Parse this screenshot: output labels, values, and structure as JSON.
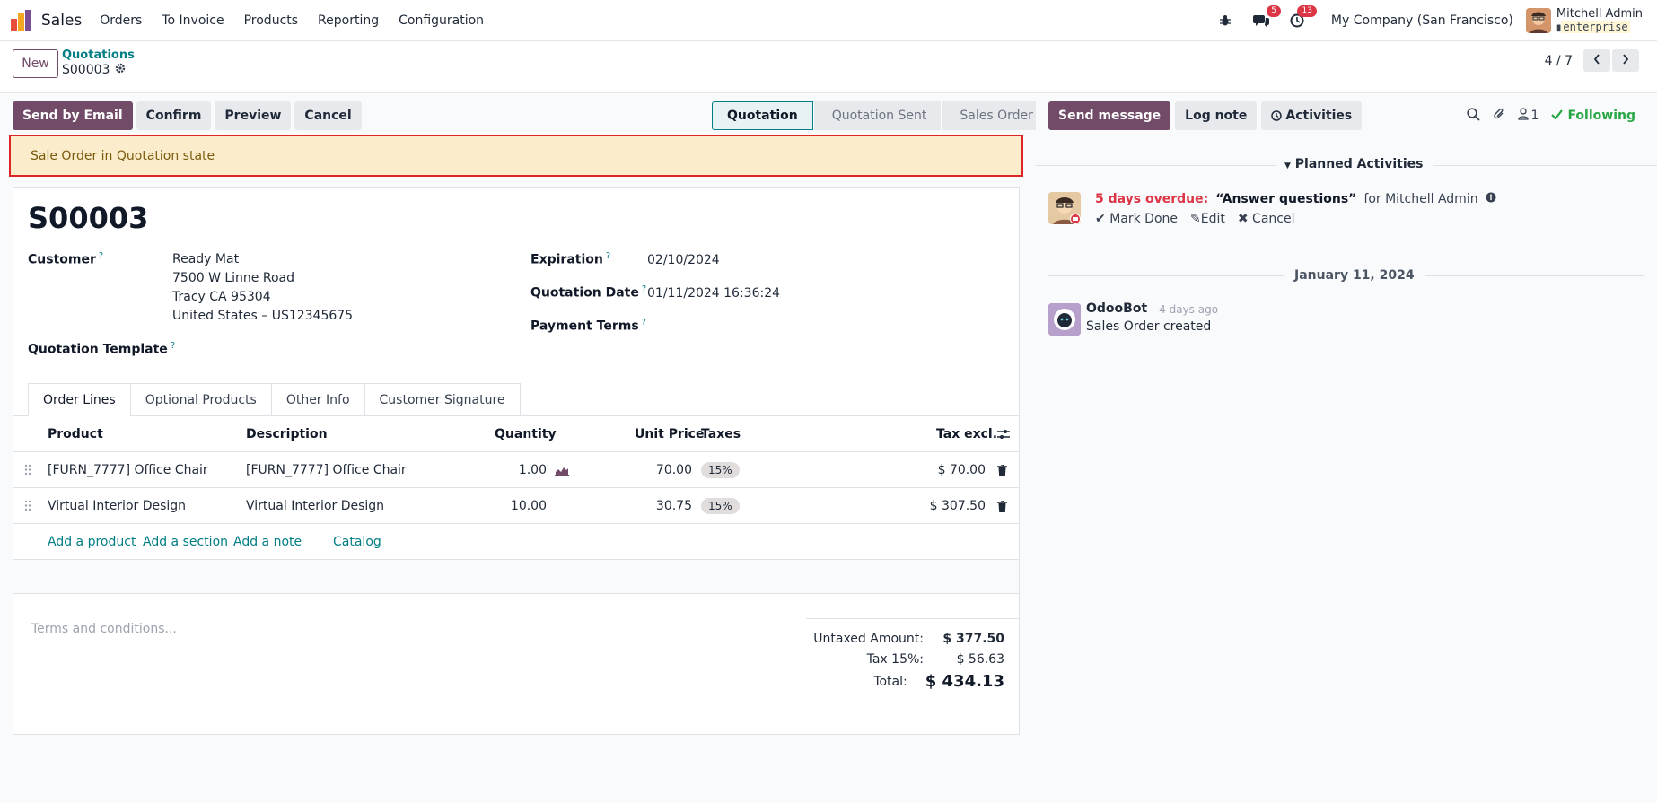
{
  "navbar": {
    "app_name": "Sales",
    "menu": [
      "Orders",
      "To Invoice",
      "Products",
      "Reporting",
      "Configuration"
    ],
    "messages_count": "5",
    "activities_count": "13",
    "company": "My Company (San Francisco)",
    "user_name": "Mitchell Admin",
    "db_name": "enterprise"
  },
  "control_panel": {
    "new_label": "New",
    "breadcrumb_parent": "Quotations",
    "breadcrumb_current": "S00003",
    "pager": "4 / 7"
  },
  "actions": {
    "send_email": "Send by Email",
    "confirm": "Confirm",
    "preview": "Preview",
    "cancel": "Cancel"
  },
  "statusbar": [
    "Quotation",
    "Quotation Sent",
    "Sales Order"
  ],
  "alert": "Sale Order in Quotation state",
  "form": {
    "name": "S00003",
    "customer_label": "Customer",
    "customer_name": "Ready Mat",
    "customer_addr1": "7500 W Linne Road",
    "customer_addr2": "Tracy CA 95304",
    "customer_addr3": "United States – US12345675",
    "template_label": "Quotation Template",
    "expiration_label": "Expiration",
    "expiration_value": "02/10/2024",
    "qdate_label": "Quotation Date",
    "qdate_value": "01/11/2024 16:36:24",
    "payment_label": "Payment Terms",
    "help_mark": "?"
  },
  "tabs": [
    "Order Lines",
    "Optional Products",
    "Other Info",
    "Customer Signature"
  ],
  "table": {
    "headers": {
      "product": "Product",
      "description": "Description",
      "quantity": "Quantity",
      "unit_price": "Unit Price",
      "taxes": "Taxes",
      "tax_excl": "Tax excl."
    },
    "rows": [
      {
        "product": "[FURN_7777] Office Chair",
        "description": "[FURN_7777] Office Chair",
        "quantity": "1.00",
        "unit_price": "70.00",
        "tax": "15%",
        "subtotal": "$ 70.00"
      },
      {
        "product": "Virtual Interior Design",
        "description": "Virtual Interior Design",
        "quantity": "10.00",
        "unit_price": "30.75",
        "tax": "15%",
        "subtotal": "$ 307.50"
      }
    ],
    "add_product": "Add a product",
    "add_section": "Add a section",
    "add_note": "Add a note",
    "catalog": "Catalog"
  },
  "terms_placeholder": "Terms and conditions...",
  "totals": {
    "untaxed_label": "Untaxed Amount:",
    "untaxed_value": "$ 377.50",
    "tax_label": "Tax 15%:",
    "tax_value": "$ 56.63",
    "total_label": "Total:",
    "total_value": "$ 434.13"
  },
  "chatter": {
    "send_message": "Send message",
    "log_note": "Log note",
    "activities": "Activities",
    "followers_count": "1",
    "following": "Following",
    "planned_title": "Planned Activities",
    "overdue": "5 days overdue:",
    "activity_summary": "“Answer questions”",
    "activity_for": "for Mitchell Admin",
    "mark_done": "Mark Done",
    "edit": "Edit",
    "cancel": "Cancel",
    "date_sep": "January 11, 2024",
    "msg_author": "OdooBot",
    "msg_date": "- 4 days ago",
    "msg_body": "Sales Order created"
  },
  "colors": {
    "brand": "#714b67",
    "link": "#017e84",
    "danger": "#dc3545",
    "success": "#28a745"
  }
}
